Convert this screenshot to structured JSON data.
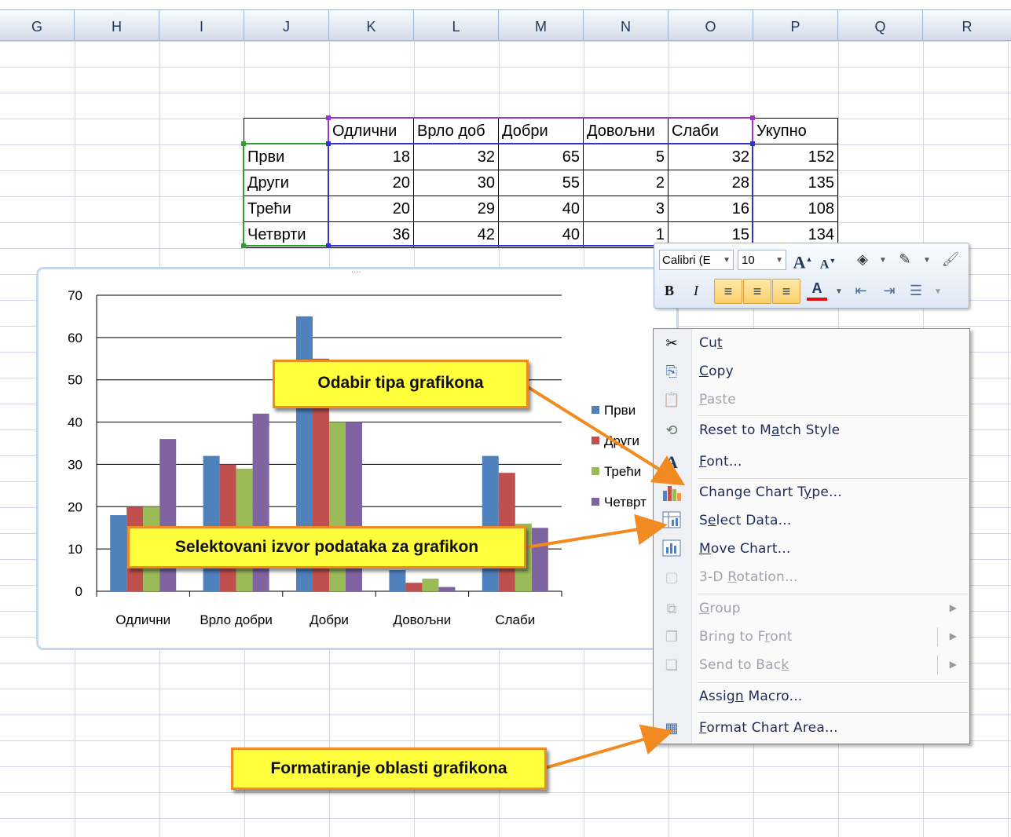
{
  "column_headers": [
    "G",
    "H",
    "I",
    "J",
    "K",
    "L",
    "M",
    "N",
    "O",
    "P",
    "Q",
    "R"
  ],
  "table": {
    "header": [
      "",
      "Одлични",
      "Врло доб",
      "Добри",
      "Довољни",
      "Слаби",
      "Укупно"
    ],
    "rows": [
      [
        "Први",
        "18",
        "32",
        "65",
        "5",
        "32",
        "152"
      ],
      [
        "Други",
        "20",
        "30",
        "55",
        "2",
        "28",
        "135"
      ],
      [
        "Трећи",
        "20",
        "29",
        "40",
        "3",
        "16",
        "108"
      ],
      [
        "Четврти",
        "36",
        "42",
        "40",
        "1",
        "15",
        "134"
      ]
    ]
  },
  "chart_data": {
    "type": "bar",
    "categories": [
      "Одлични",
      "Врло добри",
      "Добри",
      "Довољни",
      "Слаби"
    ],
    "series": [
      {
        "name": "Први",
        "values": [
          18,
          32,
          65,
          5,
          32
        ],
        "color": "#4f81bd"
      },
      {
        "name": "Други",
        "values": [
          20,
          30,
          55,
          2,
          28
        ],
        "color": "#c0504d"
      },
      {
        "name": "Трећи",
        "values": [
          20,
          29,
          40,
          3,
          16
        ],
        "color": "#9bbb59"
      },
      {
        "name": "Четврт",
        "values": [
          36,
          42,
          40,
          1,
          15
        ],
        "color": "#8064a2"
      }
    ],
    "ylim": [
      0,
      70
    ],
    "yticks": [
      "0",
      "10",
      "20",
      "30",
      "40",
      "50",
      "60",
      "70"
    ],
    "grid": true,
    "legend": "right"
  },
  "mini_toolbar": {
    "font": "Calibri (E",
    "size": "10",
    "grow_font": "A",
    "shrink_font": "A",
    "bold": "B",
    "italic": "I"
  },
  "context_menu": {
    "items": [
      {
        "key": "cut",
        "pre": "Cu",
        "acc": "t",
        "post": "",
        "icon": "scissors-icon"
      },
      {
        "key": "copy",
        "pre": "",
        "acc": "C",
        "post": "opy",
        "icon": "copy-icon"
      },
      {
        "key": "paste",
        "pre": "",
        "acc": "P",
        "post": "aste",
        "icon": "paste-icon",
        "disabled": true
      },
      {
        "key": "reset",
        "pre": "Reset to M",
        "acc": "a",
        "post": "tch Style",
        "icon": "reset-style-icon"
      },
      {
        "key": "font",
        "pre": "",
        "acc": "F",
        "post": "ont...",
        "icon": "font-icon"
      },
      {
        "key": "change_type",
        "pre": "Change Chart T",
        "acc": "y",
        "post": "pe...",
        "icon": "chart-type-icon"
      },
      {
        "key": "select_data",
        "pre": "S",
        "acc": "e",
        "post": "lect Data...",
        "icon": "select-data-icon"
      },
      {
        "key": "move_chart",
        "pre": "",
        "acc": "M",
        "post": "ove Chart...",
        "icon": "move-chart-icon"
      },
      {
        "key": "rotation",
        "pre": "3-D ",
        "acc": "R",
        "post": "otation...",
        "icon": "3d-rotation-icon",
        "disabled": true
      },
      {
        "key": "group",
        "pre": "",
        "acc": "G",
        "post": "roup",
        "icon": "group-icon",
        "disabled": true
      },
      {
        "key": "bring_front",
        "pre": "Bring to F",
        "acc": "r",
        "post": "ont",
        "icon": "bring-front-icon",
        "disabled": true
      },
      {
        "key": "send_back",
        "pre": "Send to Bac",
        "acc": "k",
        "post": "",
        "icon": "send-back-icon",
        "disabled": true
      },
      {
        "key": "assign_macro",
        "pre": "Assig",
        "acc": "n",
        "post": " Macro...",
        "icon": ""
      },
      {
        "key": "format_area",
        "pre": "",
        "acc": "F",
        "post": "ormat Chart Area...",
        "icon": "format-area-icon"
      }
    ]
  },
  "callouts": {
    "chart_type": "Odabir tipa grafikona",
    "source": "Selektovani izvor podataka za grafikon",
    "format": "Formatiranje oblasti grafikona"
  }
}
